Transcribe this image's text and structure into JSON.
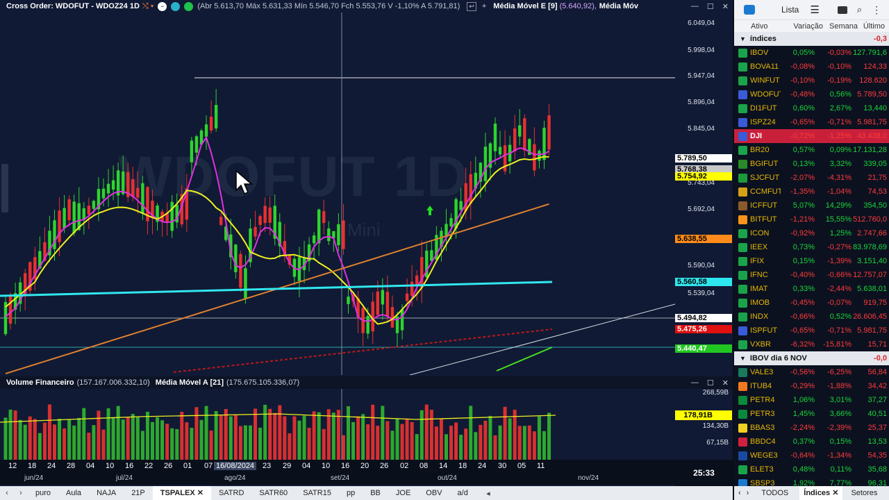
{
  "chart": {
    "title": "Cross Order: WDOFUT - WDOZ24 1D",
    "ohlc_text": "(Abr 5.613,70 Máx 5.631,33 Mín 5.546,70 Fch 5.553,76 V -1,10% A 5.791,81)",
    "ma_title": "Média Móvel E [9]",
    "ma_value": "(5.640,92),",
    "ma_title2": "Média Móv",
    "watermark": "WDOFUT 1D",
    "watermark_sub": "Mini",
    "price_ticks": [
      "6.049,04",
      "5.998,04",
      "5.947,04",
      "5.896,04",
      "5.845,04",
      "5.743,04",
      "5.692,04",
      "5.590,04",
      "5.539,04"
    ],
    "price_labels": [
      {
        "text": "5.789,50",
        "bg": "#ffffff",
        "fg": "#000000"
      },
      {
        "text": "5.768,38",
        "bg": "#c8c8c8",
        "fg": "#000000"
      },
      {
        "text": "5.754,92",
        "bg": "#ffff00",
        "fg": "#000000"
      },
      {
        "text": "5.638,55",
        "bg": "#ff8c1a",
        "fg": "#000000"
      },
      {
        "text": "5.560,58",
        "bg": "#2ee6f0",
        "fg": "#000000"
      },
      {
        "text": "5.494,82",
        "bg": "#ffffff",
        "fg": "#000000"
      },
      {
        "text": "5.475,26",
        "bg": "#e01010",
        "fg": "#ffffff"
      },
      {
        "text": "5.440,47",
        "bg": "#22c822",
        "fg": "#ffffff"
      }
    ],
    "volume": {
      "title": "Volume Financeiro",
      "value": "(157.167.006.332,10)",
      "ma_title": "Média Móvel A [21]",
      "ma_value": "(175.675.105.336,07)",
      "ticks": [
        "268,59B",
        "134,30B",
        "67,15B"
      ],
      "label": "178,91B"
    },
    "dates": [
      "12",
      "18",
      "24",
      "28",
      "04",
      "10",
      "16",
      "22",
      "26",
      "01",
      "07",
      "16/08/2024",
      "23",
      "29",
      "04",
      "10",
      "16",
      "20",
      "26",
      "02",
      "08",
      "14",
      "18",
      "24",
      "30",
      "05",
      "11"
    ],
    "months": [
      "jun/24",
      "jul/24",
      "ago/24",
      "set/24",
      "out/24",
      "nov/24"
    ],
    "clock": "25:33"
  },
  "tabs": {
    "items": [
      "puro",
      "Aula",
      "NAJA",
      "21P",
      "TSPALEX",
      "SATRD",
      "SATR60",
      "SATR15",
      "pp",
      "BB",
      "JOE",
      "OBV",
      "a/d"
    ],
    "active": "TSPALEX"
  },
  "sidebar": {
    "list_label": "Lista",
    "columns": [
      "Ativo",
      "Variação",
      "Semana",
      "Último"
    ],
    "groups": [
      {
        "name": "índices",
        "value": "-0,3",
        "rows": [
          {
            "sym": "IBOV",
            "flag": "#1aa34a",
            "v": "0,05%",
            "w": "-0,03%",
            "l": "127.791,6"
          },
          {
            "sym": "BOVA11",
            "flag": "#1aa34a",
            "v": "-0,08%",
            "w": "-0,10%",
            "l": "124,33"
          },
          {
            "sym": "WINFUT",
            "flag": "#1aa34a",
            "v": "-0,10%",
            "w": "-0,19%",
            "l": "128.620"
          },
          {
            "sym": "WDOFUT",
            "flag": "#3a5bd8",
            "v": "-0,48%",
            "w": "0,56%",
            "l": "5.789,50"
          },
          {
            "sym": "DI1FUT",
            "flag": "#1aa34a",
            "v": "0,60%",
            "w": "2,67%",
            "l": "13,440"
          },
          {
            "sym": "ISPZ24",
            "flag": "#3a5bd8",
            "v": "-0,65%",
            "w": "-0,71%",
            "l": "5.981,75"
          },
          {
            "sym": "DJI",
            "flag": "#3a5bd8",
            "v": "-0,72%",
            "w": "-1,25%",
            "l": "43.438,0"
          },
          {
            "sym": "BR20",
            "flag": "#1aa34a",
            "v": "0,57%",
            "w": "0,09%",
            "l": "17.131,28"
          },
          {
            "sym": "BGIFUT",
            "flag": "#2a8a2a",
            "v": "0,13%",
            "w": "3,32%",
            "l": "339,05"
          },
          {
            "sym": "SJCFUT",
            "flag": "#1c9a3c",
            "v": "-2,07%",
            "w": "-4,31%",
            "l": "21,75"
          },
          {
            "sym": "CCMFUT",
            "flag": "#d4a017",
            "v": "-1,35%",
            "w": "-1,04%",
            "l": "74,53"
          },
          {
            "sym": "ICFFUT",
            "flag": "#8b5a2b",
            "v": "5,07%",
            "w": "14,29%",
            "l": "354,50"
          },
          {
            "sym": "BITFUT",
            "flag": "#f7931a",
            "v": "-1,21%",
            "w": "15,55%",
            "l": "512.760,0"
          },
          {
            "sym": "ICON",
            "flag": "#1aa34a",
            "v": "-0,92%",
            "w": "1,25%",
            "l": "2.747,66"
          },
          {
            "sym": "IEEX",
            "flag": "#1aa34a",
            "v": "0,73%",
            "w": "-0,27%",
            "l": "83.978,69"
          },
          {
            "sym": "IFIX",
            "flag": "#1aa34a",
            "v": "0,15%",
            "w": "-1,39%",
            "l": "3.151,40"
          },
          {
            "sym": "IFNC",
            "flag": "#1aa34a",
            "v": "-0,40%",
            "w": "-0,66%",
            "l": "12.757,07"
          },
          {
            "sym": "IMAT",
            "flag": "#1aa34a",
            "v": "0,33%",
            "w": "-2,44%",
            "l": "5.638,01"
          },
          {
            "sym": "IMOB",
            "flag": "#1aa34a",
            "v": "-0,45%",
            "w": "-0,07%",
            "l": "919,75"
          },
          {
            "sym": "INDX",
            "flag": "#1aa34a",
            "v": "-0,66%",
            "w": "0,52%",
            "l": "26.606,45"
          },
          {
            "sym": "ISPFUT",
            "flag": "#3a5bd8",
            "v": "-0,65%",
            "w": "-0,71%",
            "l": "5.981,75"
          },
          {
            "sym": "VXBR",
            "flag": "#1aa34a",
            "v": "-6,32%",
            "w": "-15,81%",
            "l": "15,71"
          }
        ]
      },
      {
        "name": "IBOV dia 6 NOV",
        "value": "-0,0",
        "rows": [
          {
            "sym": "VALE3",
            "flag": "#1a7a5a",
            "v": "-0,56%",
            "w": "-6,25%",
            "l": "56,84"
          },
          {
            "sym": "ITUB4",
            "flag": "#f07820",
            "v": "-0,29%",
            "w": "-1,88%",
            "l": "34,42"
          },
          {
            "sym": "PETR4",
            "flag": "#0a8a3a",
            "v": "1,06%",
            "w": "3,01%",
            "l": "37,27"
          },
          {
            "sym": "PETR3",
            "flag": "#0a8a3a",
            "v": "1,45%",
            "w": "3,66%",
            "l": "40,51"
          },
          {
            "sym": "BBAS3",
            "flag": "#f0d020",
            "v": "-2,24%",
            "w": "-2,39%",
            "l": "25,37"
          },
          {
            "sym": "BBDC4",
            "flag": "#d02040",
            "v": "0,37%",
            "w": "0,15%",
            "l": "13,53"
          },
          {
            "sym": "WEGE3",
            "flag": "#1a4aa0",
            "v": "-0,64%",
            "w": "-1,34%",
            "l": "54,35"
          },
          {
            "sym": "ELET3",
            "flag": "#1aa34a",
            "v": "0,48%",
            "w": "0,11%",
            "l": "35,68"
          },
          {
            "sym": "SBSP3",
            "flag": "#1a7ad0",
            "v": "1,92%",
            "w": "7,77%",
            "l": "96,31"
          }
        ]
      }
    ],
    "bottom": {
      "all": "TODOS",
      "indices": "Índices",
      "sectors": "Setores"
    }
  }
}
